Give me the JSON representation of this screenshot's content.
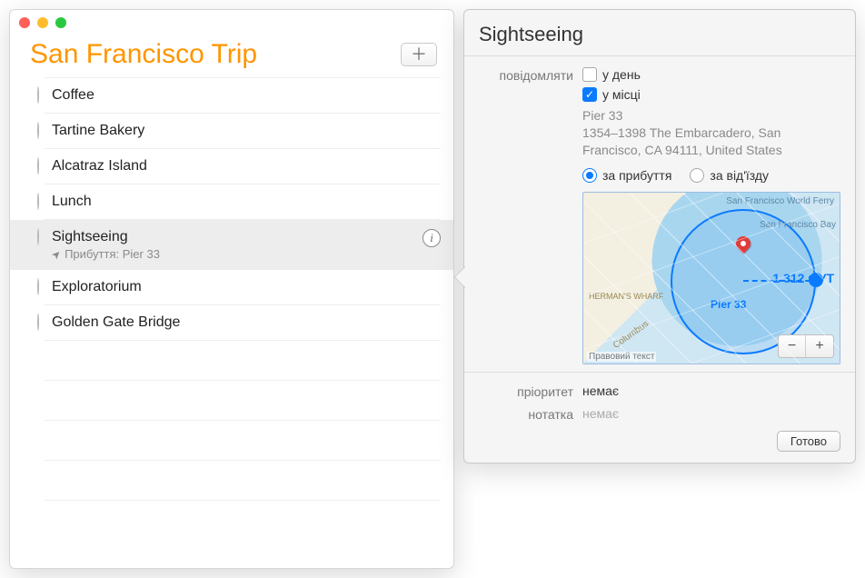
{
  "list": {
    "title": "San Francisco Trip",
    "items": [
      {
        "title": "Coffee"
      },
      {
        "title": "Tartine Bakery"
      },
      {
        "title": "Alcatraz Island"
      },
      {
        "title": "Lunch"
      },
      {
        "title": "Sightseeing",
        "subtitle": "Прибуття: Pier 33",
        "selected": true
      },
      {
        "title": "Exploratorium"
      },
      {
        "title": "Golden Gate Bridge"
      }
    ]
  },
  "detail": {
    "title": "Sightseeing",
    "labels": {
      "remind": "повідомляти",
      "on_day": "у день",
      "at_location": "у місці",
      "arriving": "за прибуття",
      "leaving": "за від'їзду",
      "priority": "пріоритет",
      "note": "нотатка",
      "done": "Готово"
    },
    "remind_on_day_checked": false,
    "remind_at_location_checked": true,
    "location_name": "Pier 33",
    "location_address": "1354–1398 The Embarcadero, San Francisco, CA  94111, United States",
    "arrival_selected": true,
    "map": {
      "pin_label": "Pier 33",
      "distance_label": "1 312 ФУТ",
      "attribution": "Правовий текст",
      "text_ferry": "San Francisco World Ferry",
      "text_bay": "San Francisco Bay",
      "text_wharf": "HERMAN'S WHARF",
      "text_street": "Columbus"
    },
    "priority_value": "немає",
    "note_placeholder": "немає"
  }
}
